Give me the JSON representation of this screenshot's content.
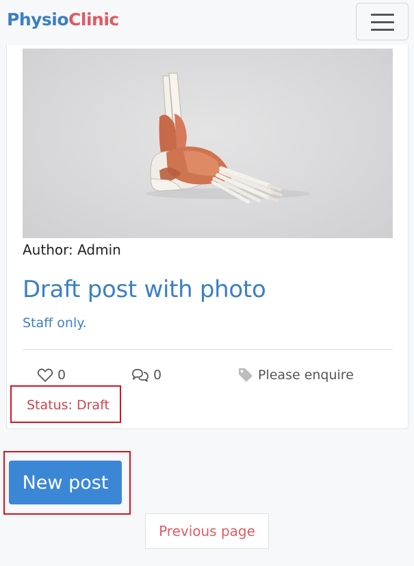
{
  "navbar": {
    "brand_part1": "Physio",
    "brand_part2": "Clinic",
    "menu_icon": "hamburger-menu-icon"
  },
  "post": {
    "image_subject": "anatomical foot skeleton model",
    "author": "Author: Admin",
    "title": "Draft post with photo",
    "excerpt": "Staff only.",
    "likes_count": "0",
    "comments_count": "0",
    "price_label": "Please enquire",
    "status": "Status: Draft",
    "icons": {
      "likes": "heart-icon",
      "comments": "comments-icon",
      "price": "tag-icon"
    }
  },
  "actions": {
    "new_post_label": "New post",
    "previous_page_label": "Previous page"
  },
  "colors": {
    "brand_blue": "#3b7fc4",
    "brand_red": "#e05a63",
    "button_blue": "#3b87d6",
    "highlight_red": "#d6121e"
  }
}
